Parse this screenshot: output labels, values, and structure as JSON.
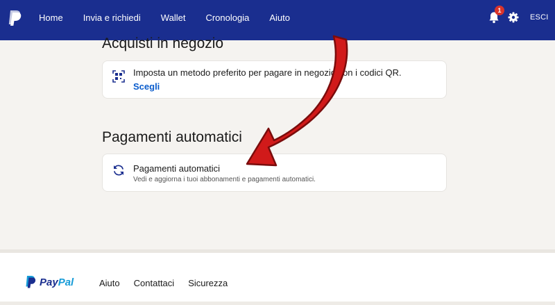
{
  "header": {
    "nav": [
      "Home",
      "Invia e richiedi",
      "Wallet",
      "Cronologia",
      "Aiuto"
    ],
    "notification_count": "1",
    "logout_label": "ESCI",
    "bar_color": "#1a2e8f"
  },
  "sections": {
    "in_store": {
      "title": "Acquisti in negozio",
      "card": {
        "icon": "qr-code-icon",
        "text": "Imposta un metodo preferito per pagare in negozio con i codici QR.",
        "link": "Scegli"
      }
    },
    "automatic": {
      "title": "Pagamenti automatici",
      "card": {
        "icon": "refresh-icon",
        "title": "Pagamenti automatici",
        "subtitle": "Vedi e aggiorna i tuoi abbonamenti e pagamenti automatici."
      }
    }
  },
  "annotation": {
    "icon": "red-arrow",
    "color": "#d11a1a"
  },
  "footer": {
    "brand_pay": "Pay",
    "brand_pal": "Pal",
    "links": [
      "Aiuto",
      "Contattaci",
      "Sicurezza"
    ]
  }
}
